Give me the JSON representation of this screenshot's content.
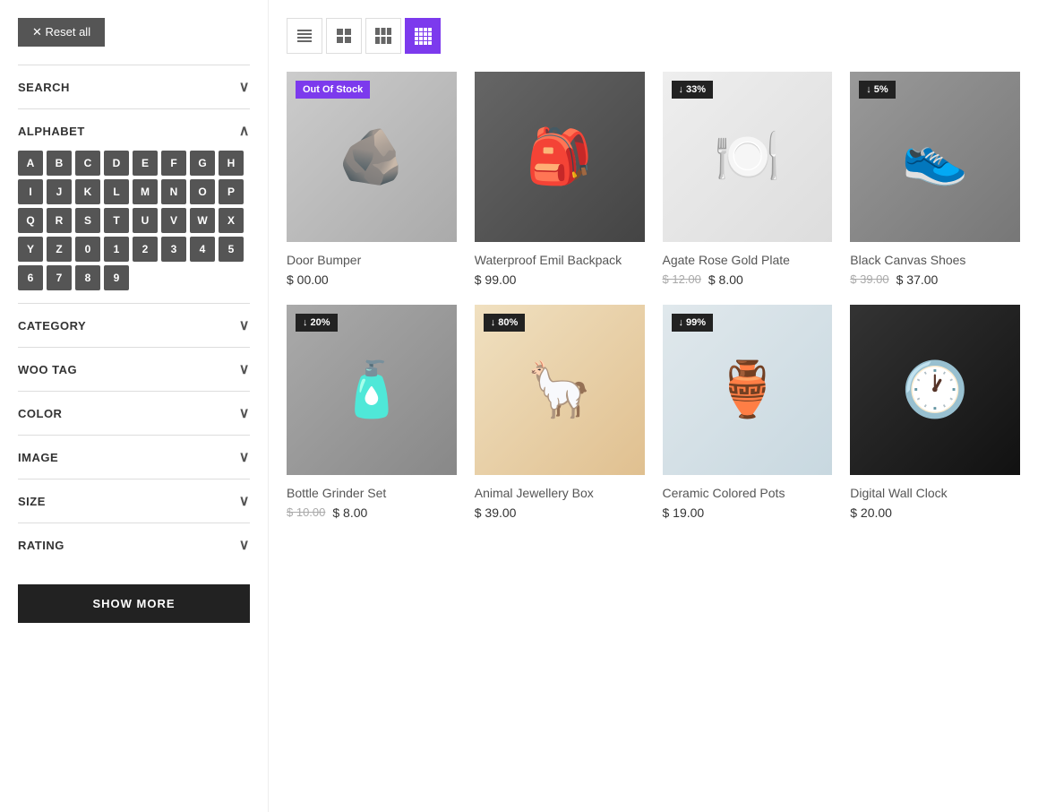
{
  "sidebar": {
    "reset_label": "✕ Reset all",
    "filters": [
      {
        "id": "search",
        "label": "SEARCH",
        "open": false
      },
      {
        "id": "alphabet",
        "label": "ALPHABET",
        "open": true
      },
      {
        "id": "category",
        "label": "CATEGORY",
        "open": false
      },
      {
        "id": "woo_tag",
        "label": "WOO TAG",
        "open": false
      },
      {
        "id": "color",
        "label": "COLOR",
        "open": false
      },
      {
        "id": "image",
        "label": "IMAGE",
        "open": false
      },
      {
        "id": "size",
        "label": "SIZE",
        "open": false
      },
      {
        "id": "rating",
        "label": "RATING",
        "open": false
      }
    ],
    "alphabet_letters": [
      "A",
      "B",
      "C",
      "D",
      "E",
      "F",
      "G",
      "H",
      "I",
      "J",
      "K",
      "L",
      "M",
      "N",
      "O",
      "P",
      "Q",
      "R",
      "S",
      "T",
      "U",
      "V",
      "W",
      "X",
      "Y",
      "Z",
      "0",
      "1",
      "2",
      "3",
      "4",
      "5",
      "6",
      "7",
      "8",
      "9"
    ],
    "show_more_label": "SHOW MORE"
  },
  "view_toggles": [
    {
      "id": "view-1",
      "icon": "list-icon",
      "label": "List view",
      "active": false
    },
    {
      "id": "view-2",
      "icon": "grid-2-icon",
      "label": "2 column grid",
      "active": false
    },
    {
      "id": "view-3",
      "icon": "grid-3-icon",
      "label": "3 column grid",
      "active": false
    },
    {
      "id": "view-4",
      "icon": "grid-4-icon",
      "label": "4 column grid",
      "active": true
    }
  ],
  "products": [
    {
      "id": 1,
      "name": "Door Bumper",
      "name_color": "normal",
      "badge": "Out Of Stock",
      "badge_type": "out",
      "price_regular": "$ 00.00",
      "price_sale": null,
      "price_original": null,
      "visual": "🪨",
      "bg": "img-door-bumper"
    },
    {
      "id": 2,
      "name": "Waterproof Emil Backpack",
      "name_color": "normal",
      "badge": null,
      "badge_type": null,
      "price_regular": "$ 99.00",
      "price_sale": null,
      "price_original": null,
      "visual": "🎒",
      "bg": "img-backpack"
    },
    {
      "id": 3,
      "name": "Agate Rose Gold Plate",
      "name_color": "normal",
      "badge": "33%",
      "badge_type": "discount",
      "price_regular": null,
      "price_sale": "$ 8.00",
      "price_original": "$ 12.00",
      "visual": "🍽️",
      "bg": "img-plate"
    },
    {
      "id": 4,
      "name": "Black Canvas Shoes",
      "name_color": "normal",
      "badge": "5%",
      "badge_type": "discount",
      "price_regular": null,
      "price_sale": "$ 37.00",
      "price_original": "$ 39.00",
      "visual": "👟",
      "bg": "img-shoes"
    },
    {
      "id": 5,
      "name": "Bottle Grinder Set",
      "name_color": "sale",
      "badge": "20%",
      "badge_type": "discount",
      "price_regular": null,
      "price_sale": "$ 8.00",
      "price_original": "$ 10.00",
      "visual": "🧴",
      "bg": "img-bottles"
    },
    {
      "id": 6,
      "name": "Animal Jewellery Box",
      "name_color": "sale",
      "badge": "80%",
      "badge_type": "discount",
      "price_regular": "$ 39.00",
      "price_sale": null,
      "price_original": null,
      "visual": "🦙",
      "bg": "img-llama"
    },
    {
      "id": 7,
      "name": "Ceramic Colored Pots",
      "name_color": "sale",
      "badge": "99%",
      "badge_type": "discount",
      "price_regular": "$ 19.00",
      "price_sale": null,
      "price_original": null,
      "visual": "🏺",
      "bg": "img-pots"
    },
    {
      "id": 8,
      "name": "Digital Wall Clock",
      "name_color": "normal",
      "badge": null,
      "badge_type": null,
      "price_regular": "$ 20.00",
      "price_sale": null,
      "price_original": null,
      "visual": "🕐",
      "bg": "img-clock"
    }
  ]
}
